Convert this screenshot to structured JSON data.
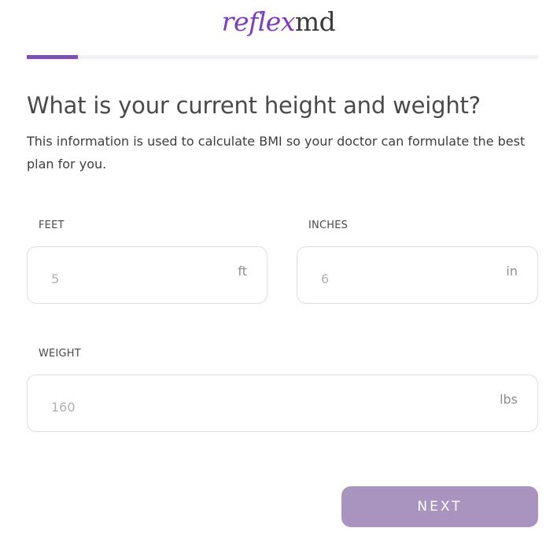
{
  "brand": {
    "logo_part1": "reflex",
    "logo_part2": "md",
    "accent_color": "#7a3cc6"
  },
  "progress": {
    "fraction": 0.1,
    "fill_color": "#7a4fb8",
    "track_color": "#f1f1f3"
  },
  "question": {
    "title": "What is your current height and weight?",
    "subtitle": "This information is used to calculate BMI so your doctor can formulate the best plan for you."
  },
  "fields": {
    "feet": {
      "label": "FEET",
      "value": "",
      "placeholder": "5",
      "unit": "ft"
    },
    "inches": {
      "label": "INCHES",
      "value": "",
      "placeholder": "6",
      "unit": "in"
    },
    "weight": {
      "label": "WEIGHT",
      "value": "",
      "placeholder": "160",
      "unit": "lbs"
    }
  },
  "actions": {
    "next_label": "NEXT",
    "next_color": "#a993bf"
  }
}
